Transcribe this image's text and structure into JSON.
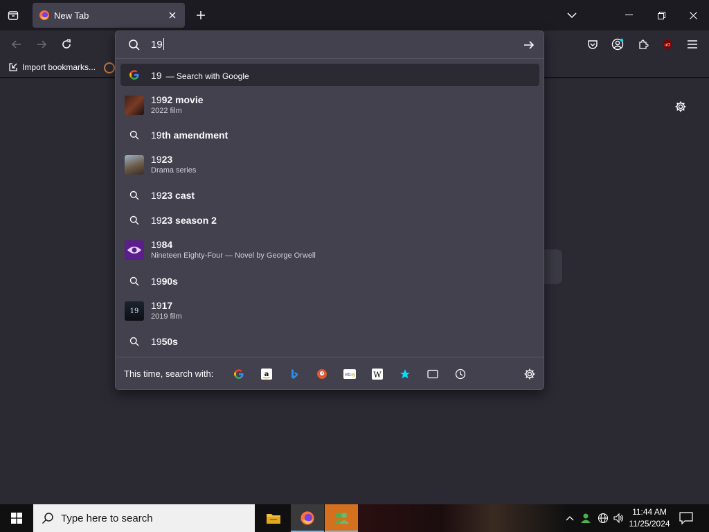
{
  "tab": {
    "title": "New Tab"
  },
  "bookmarks": {
    "import_label": "Import bookmarks..."
  },
  "urlbar": {
    "typed": "19"
  },
  "suggestions": {
    "google_query": "19",
    "google_label": "— Search with Google",
    "items": [
      {
        "prefix": "19",
        "bold": "92 movie",
        "sub": "2022 film"
      },
      {
        "prefix": "19",
        "bold": "th amendment"
      },
      {
        "prefix": "19",
        "bold": "23",
        "sub": "Drama series"
      },
      {
        "prefix": "19",
        "bold": "23 cast"
      },
      {
        "prefix": "19",
        "bold": "23 season 2"
      },
      {
        "prefix": "19",
        "bold": "84",
        "sub": "Nineteen Eighty-Four — Novel by George Orwell"
      },
      {
        "prefix": "19",
        "bold": "90s"
      },
      {
        "prefix": "19",
        "bold": "17",
        "sub": "2019 film"
      },
      {
        "prefix": "19",
        "bold": "50s"
      }
    ]
  },
  "search_with": {
    "label": "This time, search with:"
  },
  "taskbar": {
    "search_placeholder": "Type here to search",
    "time": "11:44 AM",
    "date": "11/25/2024"
  },
  "colors": {
    "accent": "#00ddff",
    "panel": "#42414d",
    "toolbar": "#2b2a33"
  }
}
